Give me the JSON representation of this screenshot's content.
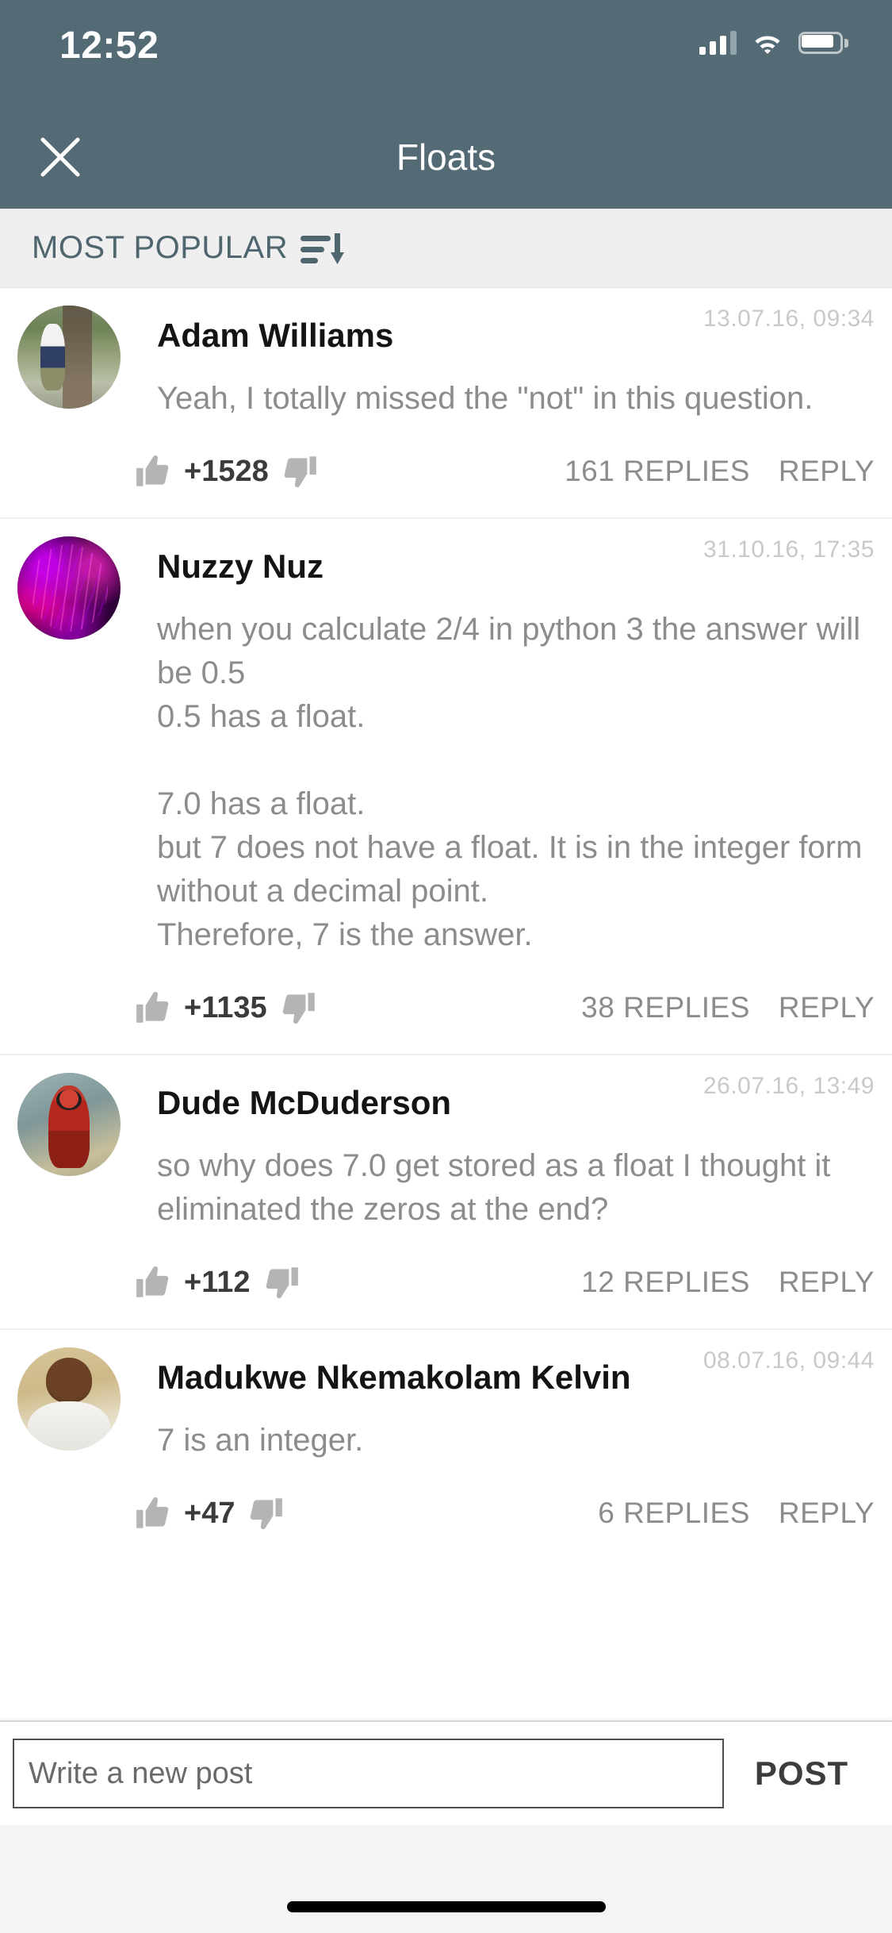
{
  "theme": {
    "header_bg": "#546a74",
    "sortbar_bg": "#efefef",
    "page_bg": "#ffffff",
    "body_text": "#8c8c8c",
    "name_text": "#141414",
    "timestamp_text": "#c9c9c9",
    "thumb_gray": "#b4b4b4"
  },
  "status_bar": {
    "time": "12:52",
    "signal_icon": "cellular-signal-icon",
    "wifi_icon": "wifi-icon",
    "battery_icon": "battery-full-icon"
  },
  "nav": {
    "close_icon": "close-icon",
    "title": "Floats"
  },
  "sort": {
    "label": "MOST POPULAR",
    "icon": "sort-descending-icon"
  },
  "comments": [
    {
      "author": "Adam Williams",
      "timestamp": "13.07.16, 09:34",
      "body": "Yeah, I totally missed the \"not\" in this question.",
      "votes": "+1528",
      "replies": "161 REPLIES",
      "reply_label": "REPLY",
      "avatar": "avatar-person-walking",
      "thumb_up_icon": "thumbs-up-icon",
      "thumb_down_icon": "thumbs-down-icon"
    },
    {
      "author": "Nuzzy Nuz",
      "timestamp": "31.10.16, 17:35",
      "body": "when you calculate 2/4 in python 3 the answer will be 0.5\n0.5 has a float.\n\n7.0 has a float.\nbut 7 does not have a float. It is in the integer form without a decimal point.\nTherefore, 7 is the answer.",
      "votes": "+1135",
      "replies": "38 REPLIES",
      "reply_label": "REPLY",
      "avatar": "avatar-purple-cat",
      "thumb_up_icon": "thumbs-up-icon",
      "thumb_down_icon": "thumbs-down-icon"
    },
    {
      "author": "Dude McDuderson",
      "timestamp": "26.07.16, 13:49",
      "body": "so why does 7.0 get stored as a float I thought it eliminated the zeros at the end?",
      "votes": "+112",
      "replies": "12 REPLIES",
      "reply_label": "REPLY",
      "avatar": "avatar-red-hero",
      "thumb_up_icon": "thumbs-up-icon",
      "thumb_down_icon": "thumbs-down-icon"
    },
    {
      "author": "Madukwe Nkemakolam Kelvin",
      "timestamp": "08.07.16, 09:44",
      "body": "7 is an integer.",
      "votes": "+47",
      "replies": "6 REPLIES",
      "reply_label": "REPLY",
      "avatar": "avatar-man-white-shirt",
      "thumb_up_icon": "thumbs-up-icon",
      "thumb_down_icon": "thumbs-down-icon"
    }
  ],
  "composer": {
    "placeholder": "Write a new post",
    "value": "",
    "post_label": "POST"
  }
}
